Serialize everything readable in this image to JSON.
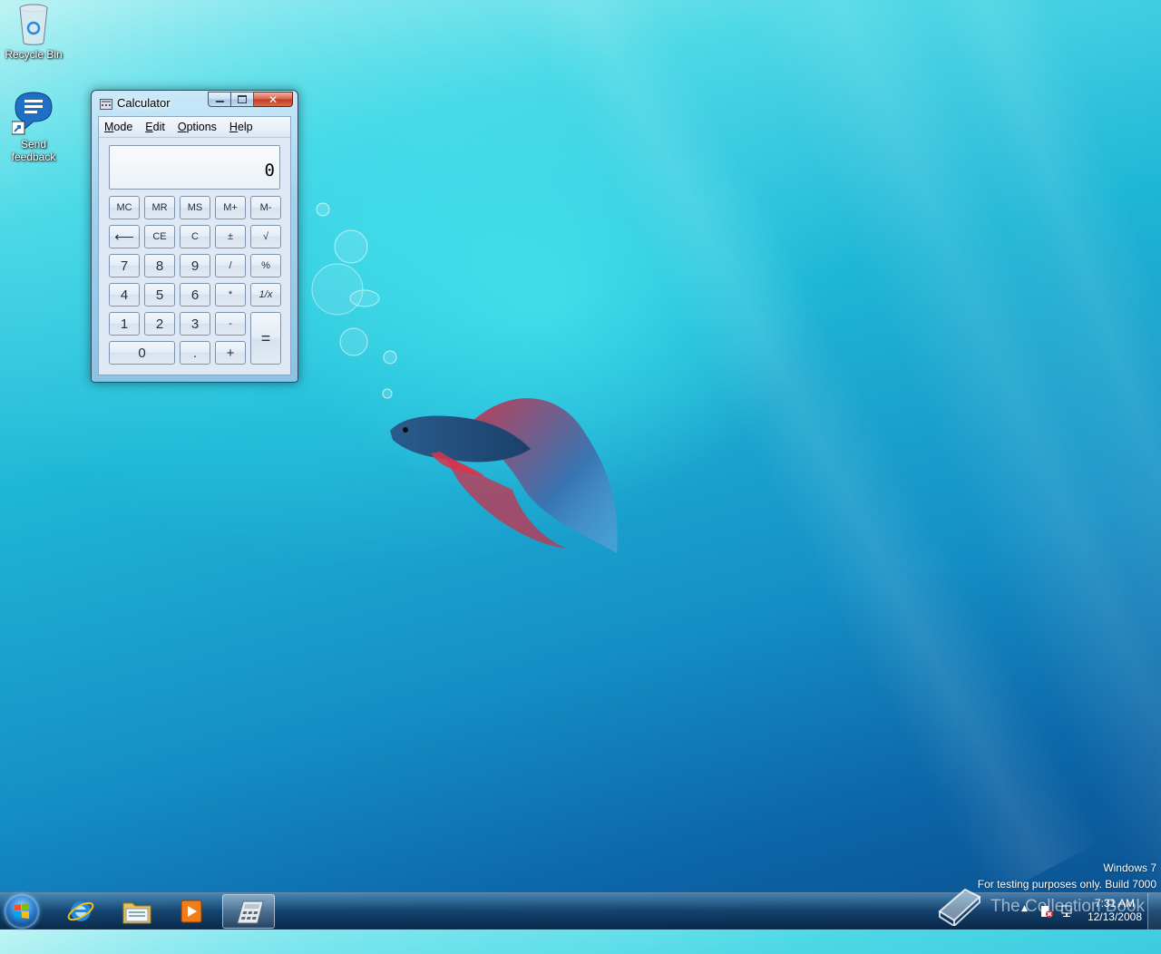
{
  "desktop": {
    "icons": [
      {
        "label": "Recycle Bin"
      },
      {
        "label": "Send feedback"
      }
    ],
    "watermark": {
      "line1": "Windows  7",
      "line2": "For testing purposes only. Build 7000"
    },
    "overlay_text": "The Collection Book"
  },
  "calculator": {
    "title": "Calculator",
    "menu": [
      "Mode",
      "Edit",
      "Options",
      "Help"
    ],
    "display_value": "0",
    "keys": {
      "mc": "MC",
      "mr": "MR",
      "ms": "MS",
      "mplus": "M+",
      "mminus": "M-",
      "back": "⟵",
      "ce": "CE",
      "c": "C",
      "plusminus": "±",
      "sqrt": "√",
      "k7": "7",
      "k8": "8",
      "k9": "9",
      "div": "/",
      "pct": "%",
      "k4": "4",
      "k5": "5",
      "k6": "6",
      "mul": "*",
      "recip": "1/x",
      "k1": "1",
      "k2": "2",
      "k3": "3",
      "sub": "-",
      "eq": "=",
      "k0": "0",
      "dot": ".",
      "add": "+"
    }
  },
  "taskbar": {
    "pinned": [
      "internet-explorer",
      "windows-explorer",
      "media-player",
      "calculator"
    ],
    "clock": {
      "time": "7:31 AM",
      "date": "12/13/2008"
    }
  }
}
